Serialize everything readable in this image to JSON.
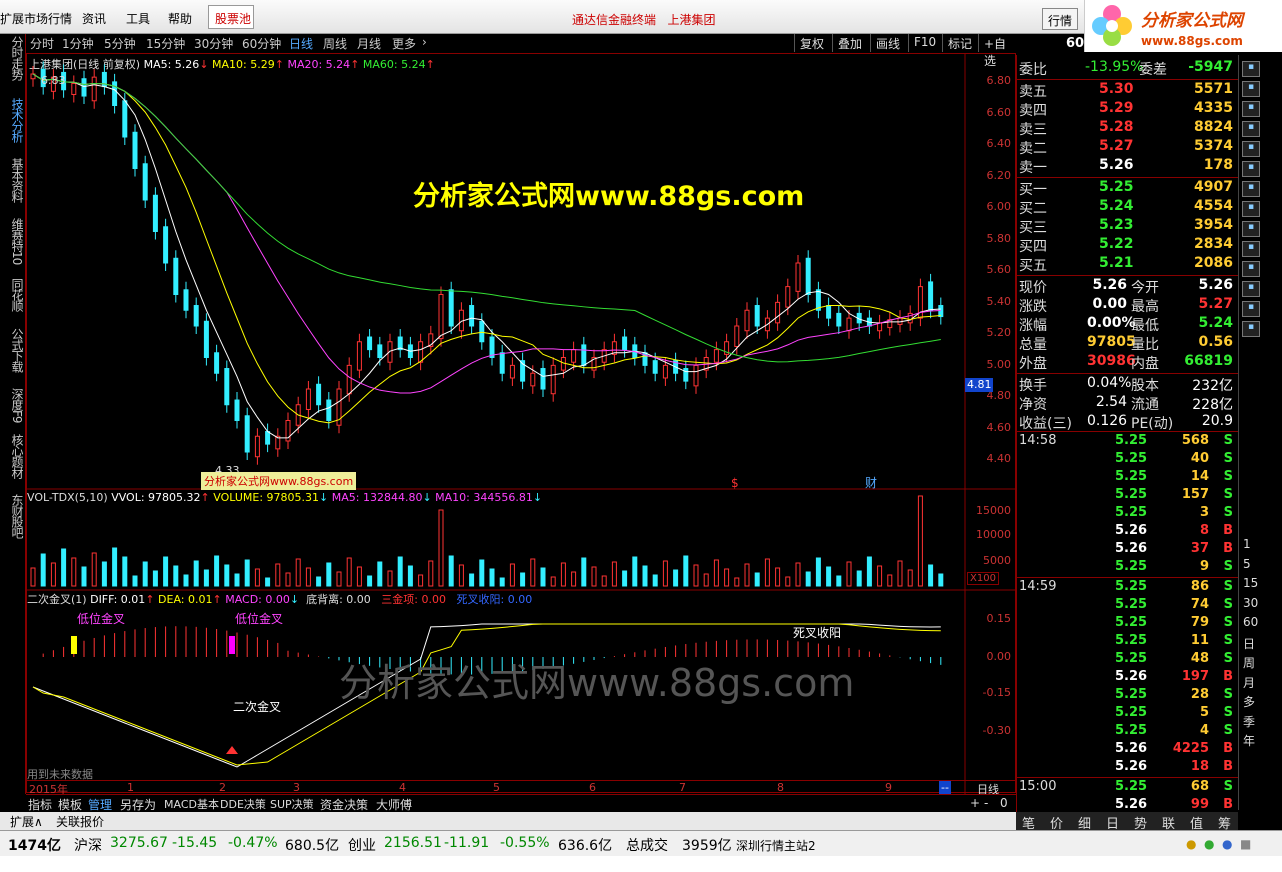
{
  "menubar": {
    "items": [
      "扩展市场行情",
      "资讯",
      "工具",
      "帮助"
    ],
    "stock_pool": "股票池",
    "center_title": "通达信金融终端",
    "center_stock": "上港集团",
    "hq_button": "行情"
  },
  "logo": {
    "text": "分析家公式网",
    "url": "www.88gs.com"
  },
  "left_tabs": [
    "分时走势",
    "技术分析",
    "基本资料",
    "维赛特10",
    "同花顺",
    "公式下载",
    "深度F9",
    "核心题材",
    "东财股吧"
  ],
  "period_bar": {
    "periods": [
      "分时",
      "1分钟",
      "5分钟",
      "15分钟",
      "30分钟",
      "60分钟",
      "日线",
      "周线",
      "月线",
      "更多"
    ],
    "active": "日线",
    "right_buttons": [
      "复权",
      "叠加",
      "画线",
      "F10",
      "标记",
      "+自选"
    ]
  },
  "main_chart": {
    "title": "上港集团(日线 前复权)",
    "ma5": "MA5: 5.26",
    "ma10": "MA10: 5.29",
    "ma20": "MA20: 5.24",
    "ma60": "MA60: 5.24",
    "high_label": "6.83",
    "low_label": "4.33",
    "price_axis": [
      "6.80",
      "6.60",
      "6.40",
      "6.20",
      "6.00",
      "5.80",
      "5.60",
      "5.40",
      "5.20",
      "5.00",
      "4.80",
      "4.60",
      "4.40"
    ],
    "current_price_tag": "4.81",
    "watermark_big": "分析家公式网www.88gs.com",
    "watermark_small": "分析家公式网www.88gs.com",
    "event_marks": [
      "$",
      "财"
    ]
  },
  "volume_chart": {
    "title": "VOL-TDX(5,10)",
    "vvol": "VVOL: 97805.32",
    "volume": "VOLUME: 97805.31",
    "ma5": "MA5: 132844.80",
    "ma10": "MA10: 344556.81",
    "axis": [
      "15000",
      "10000",
      "5000"
    ],
    "unit": "X100"
  },
  "macd_chart": {
    "title": "二次金叉(1)",
    "diff": "DIFF: 0.01",
    "dea": "DEA: 0.01",
    "macd": "MACD: 0.00",
    "bottom_dev": "底背离: 0.00",
    "three_gold": "三金项: 0.00",
    "dead_cross": "死叉收阳: 0.00",
    "annotations": [
      "低位金叉",
      "低位金叉",
      "二次金叉",
      "死叉收阳"
    ],
    "axis": [
      "0.15",
      "0.00",
      "-0.15",
      "-0.30"
    ],
    "watermark": "分析家公式网www.88gs.com",
    "future_note": "用到未来数据"
  },
  "x_axis": {
    "year": "2015年",
    "months": [
      "1",
      "2",
      "3",
      "4",
      "5",
      "6",
      "7",
      "8",
      "9"
    ],
    "period": "日线"
  },
  "bottom_tabs": [
    "指标",
    "模板",
    "管理",
    "另存为",
    "MACD基本",
    "DDE决策",
    "SUP决策",
    "资金决策",
    "大师傅"
  ],
  "bottom_tabs_active": "管理",
  "expand_bar": [
    "扩展∧",
    "关联报价"
  ],
  "quote": {
    "code": "60",
    "weibi_label": "委比",
    "weibi": "-13.95%",
    "weicha_label": "委差",
    "weicha": "-5947",
    "asks": [
      {
        "label": "卖五",
        "price": "5.30",
        "vol": "5571"
      },
      {
        "label": "卖四",
        "price": "5.29",
        "vol": "4335"
      },
      {
        "label": "卖三",
        "price": "5.28",
        "vol": "8824"
      },
      {
        "label": "卖二",
        "price": "5.27",
        "vol": "5374"
      },
      {
        "label": "卖一",
        "price": "5.26",
        "vol": "178"
      }
    ],
    "bids": [
      {
        "label": "买一",
        "price": "5.25",
        "vol": "4907"
      },
      {
        "label": "买二",
        "price": "5.24",
        "vol": "4554"
      },
      {
        "label": "买三",
        "price": "5.23",
        "vol": "3954"
      },
      {
        "label": "买四",
        "price": "5.22",
        "vol": "2834"
      },
      {
        "label": "买五",
        "price": "5.21",
        "vol": "2086"
      }
    ],
    "stats": [
      {
        "l1": "现价",
        "v1": "5.26",
        "l2": "今开",
        "v2": "5.26"
      },
      {
        "l1": "涨跌",
        "v1": "0.00",
        "l2": "最高",
        "v2": "5.27"
      },
      {
        "l1": "涨幅",
        "v1": "0.00%",
        "l2": "最低",
        "v2": "5.24"
      },
      {
        "l1": "总量",
        "v1": "97805",
        "l2": "量比",
        "v2": "0.56"
      },
      {
        "l1": "外盘",
        "v1": "30986",
        "l2": "内盘",
        "v2": "66819"
      }
    ],
    "stats2": [
      {
        "l1": "换手",
        "v1": "0.04%",
        "l2": "股本",
        "v2": "232亿"
      },
      {
        "l1": "净资",
        "v1": "2.54",
        "l2": "流通",
        "v2": "228亿"
      },
      {
        "l1": "收益(三)",
        "v1": "0.126",
        "l2": "PE(动)",
        "v2": "20.9"
      }
    ]
  },
  "ticks": [
    {
      "time": "14:58",
      "price": "5.25",
      "vol": "568",
      "side": "S"
    },
    {
      "time": "",
      "price": "5.25",
      "vol": "40",
      "side": "S"
    },
    {
      "time": "",
      "price": "5.25",
      "vol": "14",
      "side": "S"
    },
    {
      "time": "",
      "price": "5.25",
      "vol": "157",
      "side": "S"
    },
    {
      "time": "",
      "price": "5.25",
      "vol": "3",
      "side": "S"
    },
    {
      "time": "",
      "price": "5.26",
      "vol": "8",
      "side": "B"
    },
    {
      "time": "",
      "price": "5.26",
      "vol": "37",
      "side": "B"
    },
    {
      "time": "",
      "price": "5.25",
      "vol": "9",
      "side": "S"
    },
    {
      "time": "14:59",
      "price": "5.25",
      "vol": "86",
      "side": "S"
    },
    {
      "time": "",
      "price": "5.25",
      "vol": "74",
      "side": "S"
    },
    {
      "time": "",
      "price": "5.25",
      "vol": "79",
      "side": "S"
    },
    {
      "time": "",
      "price": "5.25",
      "vol": "11",
      "side": "S"
    },
    {
      "time": "",
      "price": "5.25",
      "vol": "48",
      "side": "S"
    },
    {
      "time": "",
      "price": "5.26",
      "vol": "197",
      "side": "B"
    },
    {
      "time": "",
      "price": "5.25",
      "vol": "28",
      "side": "S"
    },
    {
      "time": "",
      "price": "5.25",
      "vol": "5",
      "side": "S"
    },
    {
      "time": "",
      "price": "5.25",
      "vol": "4",
      "side": "S"
    },
    {
      "time": "",
      "price": "5.26",
      "vol": "4225",
      "side": "B"
    },
    {
      "time": "",
      "price": "5.26",
      "vol": "18",
      "side": "B"
    },
    {
      "time": "15:00",
      "price": "5.25",
      "vol": "68",
      "side": "S"
    },
    {
      "time": "",
      "price": "5.26",
      "vol": "99",
      "side": "B"
    }
  ],
  "right_bottom_tabs": [
    "笔",
    "价",
    "细",
    "日",
    "势",
    "联",
    "值",
    "筹"
  ],
  "icon_bar_labels": [
    "1",
    "5",
    "15",
    "30",
    "60",
    "日",
    "周",
    "月",
    "多",
    "季",
    "年"
  ],
  "status": {
    "amount1": "1474亿",
    "hs_label": "沪深",
    "hs_value": "3275.67",
    "hs_change": "-15.45",
    "hs_pct": "-0.47%",
    "hs_amount": "680.5亿",
    "cy_label": "创业",
    "cy_value": "2156.51",
    "cy_change": "-11.91",
    "cy_pct": "-0.55%",
    "cy_amount": "636.6亿",
    "total_label": "总成交",
    "total_value": "3959亿",
    "server": "深圳行情主站2"
  },
  "colors": {
    "up": "#ff3333",
    "down": "#33eeff",
    "ma5": "#ffffff",
    "ma10": "#ffff00",
    "ma20": "#ff44ff",
    "ma60": "#33dd33"
  }
}
